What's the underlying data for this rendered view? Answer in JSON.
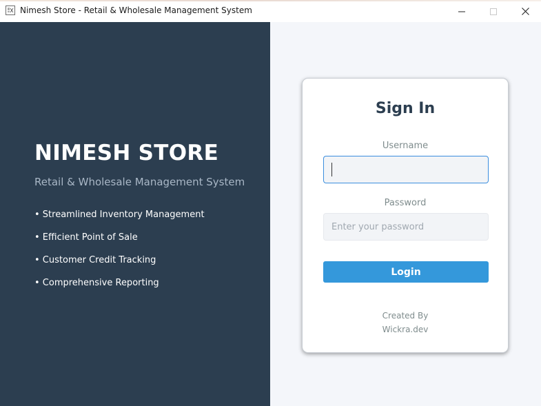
{
  "window": {
    "title": "Nimesh Store - Retail & Wholesale Management System",
    "icons": {
      "app": "app-icon",
      "minimize": "minimize-icon",
      "maximize": "maximize-icon",
      "close": "close-icon"
    }
  },
  "branding": {
    "title": "NIMESH STORE",
    "subtitle": "Retail & Wholesale Management System",
    "features": [
      "• Streamlined Inventory Management",
      "• Efficient Point of Sale",
      "• Customer Credit Tracking",
      "• Comprehensive Reporting"
    ]
  },
  "login": {
    "heading": "Sign In",
    "username_label": "Username",
    "username_value": "",
    "password_label": "Password",
    "password_value": "",
    "password_placeholder": "Enter your password",
    "button_label": "Login",
    "credit_line1": "Created By",
    "credit_line2": "Wickra.dev"
  },
  "colors": {
    "left_panel_bg": "#2c3e50",
    "right_panel_bg": "#f4f6fa",
    "accent": "#3498db",
    "heading_text": "#2c3e50",
    "muted_text": "#7f8c8d"
  }
}
